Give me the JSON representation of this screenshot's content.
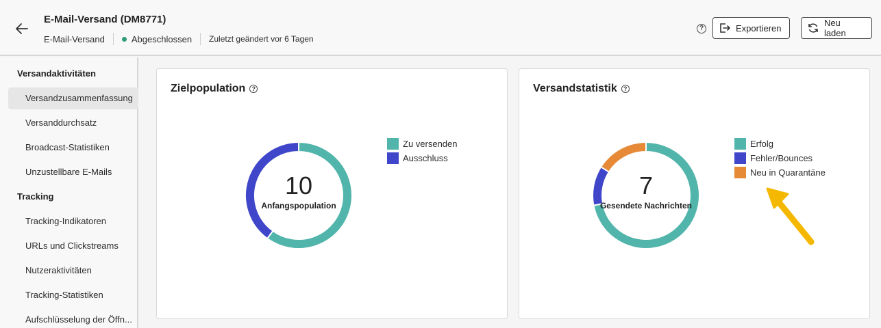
{
  "header": {
    "title": "E-Mail-Versand (DM8771)",
    "type": "E-Mail-Versand",
    "status": "Abgeschlossen",
    "modified": "Zuletzt geändert vor 6 Tagen",
    "export_label": "Exportieren",
    "reload_label": "Neu laden"
  },
  "sidebar": {
    "section1": "Versandaktivitäten",
    "items1": [
      "Versandzusammenfassung",
      "Versanddurchsatz",
      "Broadcast-Statistiken",
      "Unzustellbare E-Mails"
    ],
    "section2": "Tracking",
    "items2": [
      "Tracking-Indikatoren",
      "URLs und Clickstreams",
      "Nutzeraktivitäten",
      "Tracking-Statistiken",
      "Aufschlüsselung der Öffn..."
    ]
  },
  "cards": {
    "target": {
      "title": "Zielpopulation",
      "center_value": "10",
      "center_label": "Anfangspopulation",
      "legend": [
        {
          "label": "Zu versenden",
          "color": "#52b5ab"
        },
        {
          "label": "Ausschluss",
          "color": "#4046ca"
        }
      ]
    },
    "stats": {
      "title": "Versandstatistik",
      "center_value": "7",
      "center_label": "Gesendete Nachrichten",
      "legend": [
        {
          "label": "Erfolg",
          "color": "#52b5ab"
        },
        {
          "label": "Fehler/Bounces",
          "color": "#4046ca"
        },
        {
          "label": "Neu in Quarantäne",
          "color": "#e68a37"
        }
      ]
    }
  },
  "colors": {
    "teal": "#52b5ab",
    "blue": "#4046ca",
    "orange": "#e68a37",
    "status_green": "#2d9d78",
    "arrow_yellow": "#f5b800"
  },
  "chart_data": [
    {
      "type": "pie",
      "title": "Zielpopulation",
      "categories": [
        "Zu versenden",
        "Ausschluss"
      ],
      "values": [
        0.6,
        0.4
      ]
    },
    {
      "type": "pie",
      "title": "Versandstatistik",
      "categories": [
        "Erfolg",
        "Fehler/Bounces",
        "Neu in Quarantäne"
      ],
      "values": [
        0.72,
        0.12,
        0.16
      ]
    }
  ]
}
